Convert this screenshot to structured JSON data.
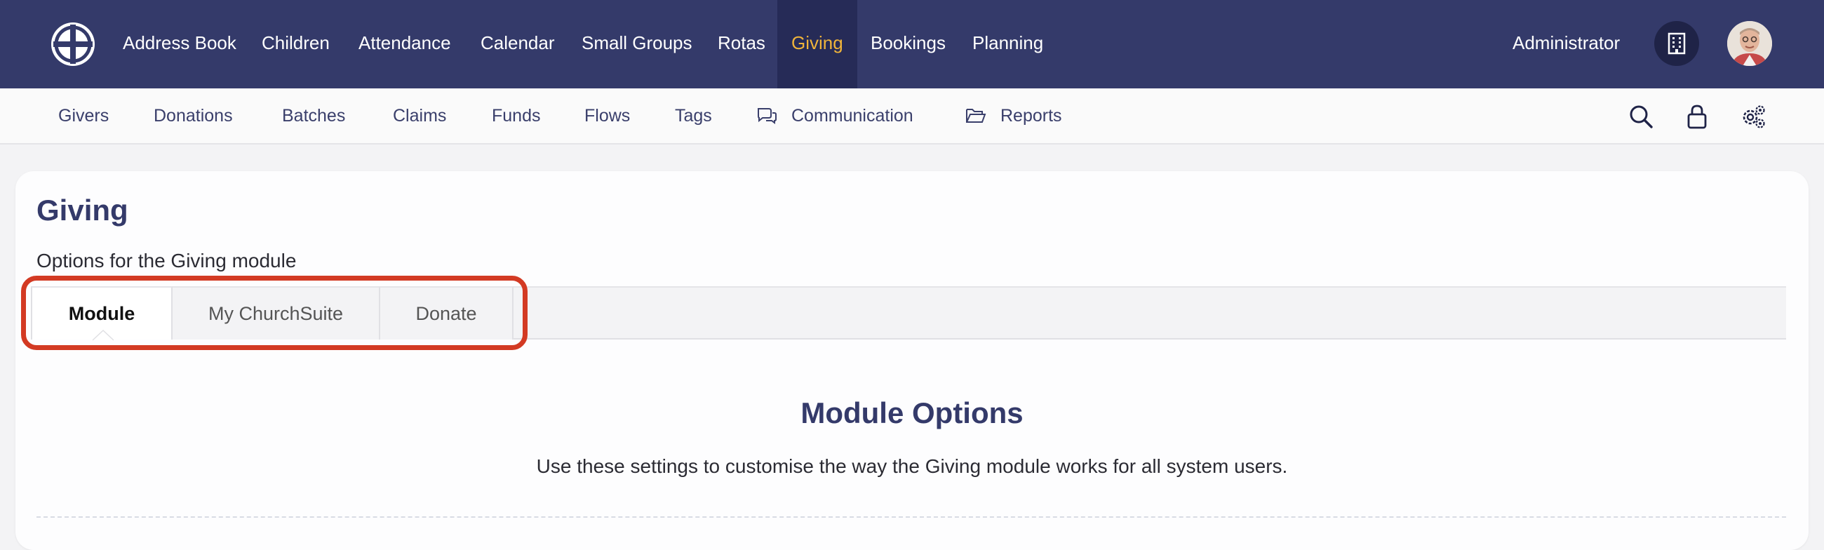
{
  "topnav": {
    "items": [
      {
        "label": "Address Book"
      },
      {
        "label": "Children"
      },
      {
        "label": "Attendance"
      },
      {
        "label": "Calendar"
      },
      {
        "label": "Small Groups"
      },
      {
        "label": "Rotas"
      },
      {
        "label": "Giving"
      },
      {
        "label": "Bookings"
      },
      {
        "label": "Planning"
      }
    ],
    "active_item": "Giving",
    "user_label": "Administrator",
    "logo_icon": "cross-circle-icon",
    "org_icon": "building-icon",
    "avatar_icon": "user-avatar"
  },
  "subnav": {
    "items": [
      {
        "label": "Givers"
      },
      {
        "label": "Donations"
      },
      {
        "label": "Batches"
      },
      {
        "label": "Claims"
      },
      {
        "label": "Funds"
      },
      {
        "label": "Flows"
      },
      {
        "label": "Tags"
      },
      {
        "label": "Communication",
        "icon": "chat-bubbles-icon"
      },
      {
        "label": "Reports",
        "icon": "folder-open-icon"
      }
    ],
    "tools": [
      "search-icon",
      "lock-icon",
      "settings-icon"
    ]
  },
  "page": {
    "title": "Giving",
    "subtitle": "Options for the Giving module",
    "tabs": [
      {
        "label": "Module"
      },
      {
        "label": "My ChurchSuite"
      },
      {
        "label": "Donate"
      }
    ],
    "active_tab": "Module",
    "section_title": "Module Options",
    "section_description": "Use these settings to customise the way the Giving module works for all system users."
  },
  "colors": {
    "nav_background": "#343a6a",
    "nav_active_text": "#f0b43a",
    "heading": "#343a6a",
    "highlight_outline": "#d33a23"
  }
}
